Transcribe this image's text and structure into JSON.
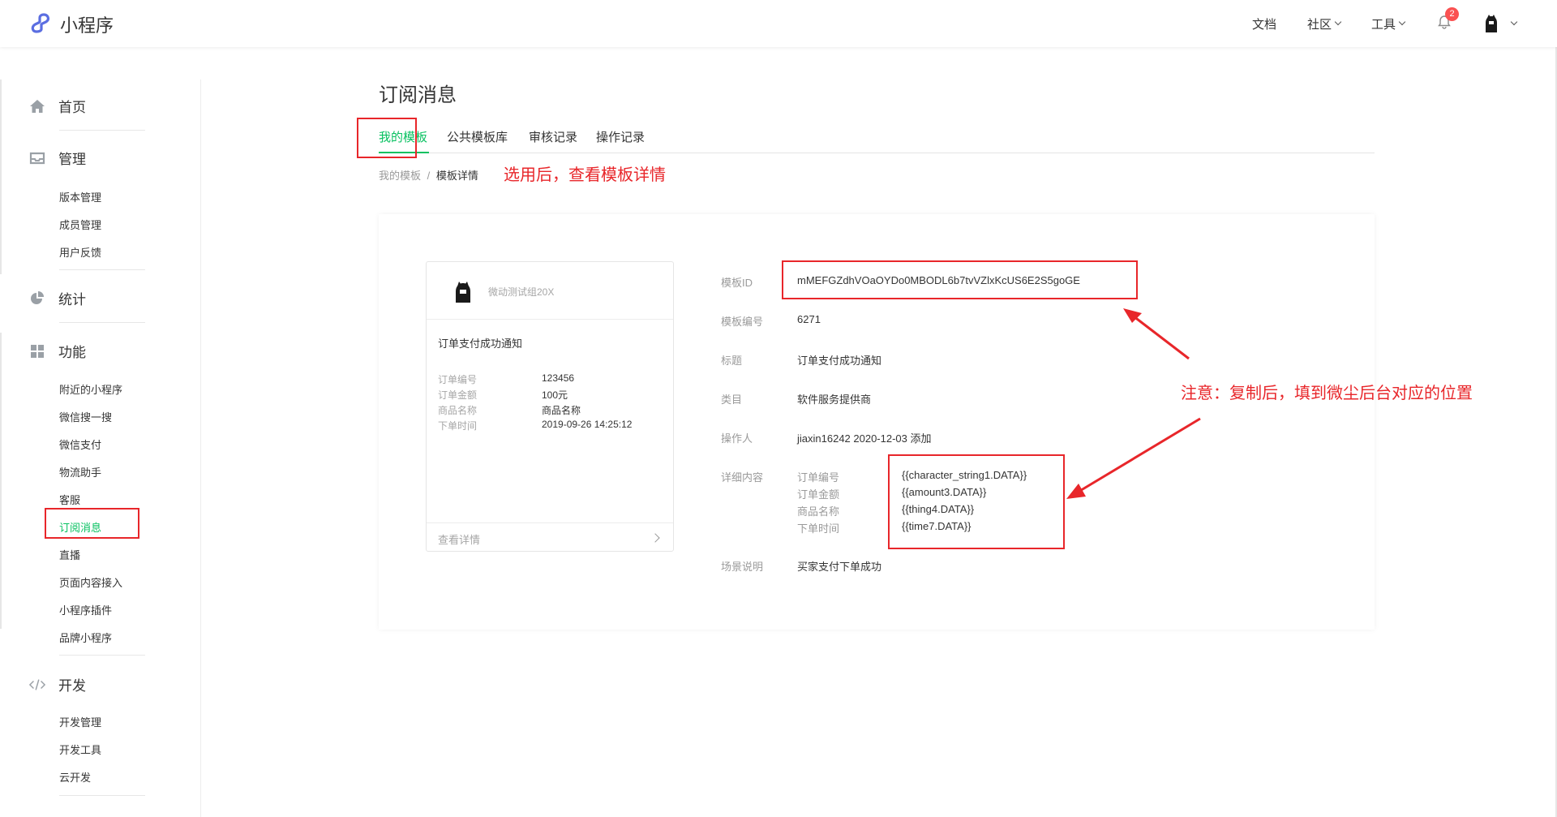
{
  "header": {
    "logo_text": "小程序",
    "nav": [
      "文档",
      "社区",
      "工具"
    ],
    "notification_count": "2"
  },
  "sidebar": {
    "sections": [
      {
        "label": "首页",
        "icon": "home-icon",
        "items": []
      },
      {
        "label": "管理",
        "icon": "inbox-icon",
        "items": [
          "版本管理",
          "成员管理",
          "用户反馈"
        ]
      },
      {
        "label": "统计",
        "icon": "pie-chart-icon",
        "items": []
      },
      {
        "label": "功能",
        "icon": "grid-icon",
        "items": [
          "附近的小程序",
          "微信搜一搜",
          "微信支付",
          "物流助手",
          "客服",
          "订阅消息",
          "直播",
          "页面内容接入",
          "小程序插件",
          "品牌小程序"
        ]
      },
      {
        "label": "开发",
        "icon": "code-icon",
        "items": [
          "开发管理",
          "开发工具",
          "云开发"
        ]
      }
    ],
    "active_item": "订阅消息"
  },
  "page": {
    "title": "订阅消息",
    "tabs": [
      "我的模板",
      "公共模板库",
      "审核记录",
      "操作记录"
    ],
    "breadcrumb": {
      "parent": "我的模板",
      "sep": "/",
      "current": "模板详情"
    }
  },
  "preview": {
    "account_name": "微动测试组20X",
    "message_title": "订单支付成功通知",
    "rows": [
      {
        "label": "订单编号",
        "value": "123456"
      },
      {
        "label": "订单金额",
        "value": "100元"
      },
      {
        "label": "商品名称",
        "value": "商品名称"
      },
      {
        "label": "下单时间",
        "value": "2019-09-26 14:25:12"
      }
    ],
    "footer_link": "查看详情"
  },
  "details": {
    "template_id_label": "模板ID",
    "template_id": "mMEFGZdhVOaOYDo0MBODL6b7tvVZlxKcUS6E2S5goGE",
    "number_label": "模板编号",
    "number": "6271",
    "title_label": "标题",
    "title": "订单支付成功通知",
    "category_label": "类目",
    "category": "软件服务提供商",
    "operator_label": "操作人",
    "operator": "jiaxin16242 2020-12-03 添加",
    "content_label": "详细内容",
    "keywords": [
      {
        "label": "订单编号",
        "value": "{{character_string1.DATA}}"
      },
      {
        "label": "订单金额",
        "value": "{{amount3.DATA}}"
      },
      {
        "label": "商品名称",
        "value": "{{thing4.DATA}}"
      },
      {
        "label": "下单时间",
        "value": "{{time7.DATA}}"
      }
    ],
    "scene_label": "场景说明",
    "scene": "买家支付下单成功"
  },
  "annotations": {
    "select_note": "选用后，查看模板详情",
    "copy_note": "注意：复制后，填到微尘后台对应的位置"
  },
  "colors": {
    "accent": "#07c160",
    "annotation": "#e8262a",
    "badge": "#fa5151"
  }
}
